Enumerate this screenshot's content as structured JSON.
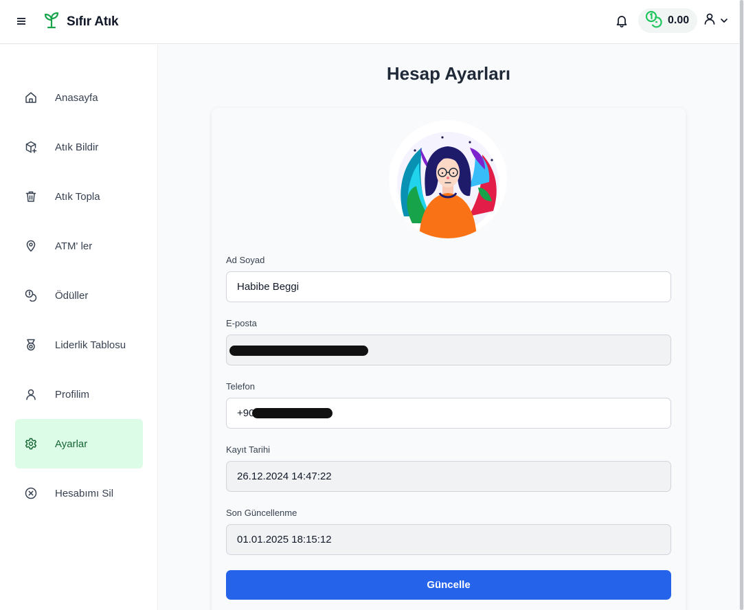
{
  "app": {
    "name": "Sıfır Atık"
  },
  "header": {
    "balance": "0.00"
  },
  "sidebar": {
    "items": [
      {
        "label": "Anasayfa",
        "icon": "home-icon"
      },
      {
        "label": "Atık Bildir",
        "icon": "package-plus-icon"
      },
      {
        "label": "Atık Topla",
        "icon": "trash-icon"
      },
      {
        "label": "ATM' ler",
        "icon": "map-pin-icon"
      },
      {
        "label": "Ödüller",
        "icon": "coins-icon"
      },
      {
        "label": "Liderlik Tablosu",
        "icon": "medal-icon"
      },
      {
        "label": "Profilim",
        "icon": "user-icon"
      },
      {
        "label": "Ayarlar",
        "icon": "gear-icon",
        "active": true
      },
      {
        "label": "Hesabımı Sil",
        "icon": "circle-x-icon"
      }
    ]
  },
  "main": {
    "title": "Hesap Ayarları",
    "fields": {
      "name": {
        "label": "Ad Soyad",
        "value": "Habibe Beggi"
      },
      "email": {
        "label": "E-posta",
        "value": ""
      },
      "phone": {
        "label": "Telefon",
        "value": "+90"
      },
      "created": {
        "label": "Kayıt Tarihi",
        "value": "26.12.2024 14:47:22"
      },
      "updated": {
        "label": "Son Güncellenme",
        "value": "01.01.2025 18:15:12"
      }
    },
    "submit_label": "Güncelle"
  },
  "colors": {
    "brand_green": "#16a34a",
    "active_bg": "#dcfce7",
    "primary_button": "#2563eb"
  }
}
